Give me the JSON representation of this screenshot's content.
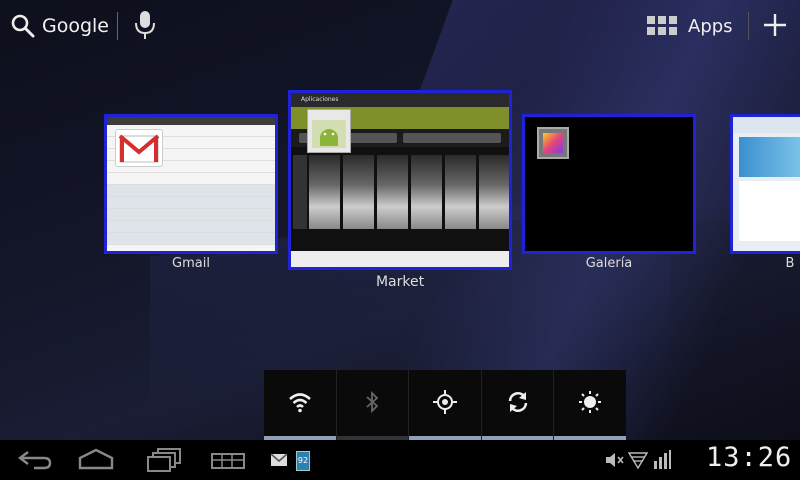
{
  "topbar": {
    "search_label": "Google",
    "apps_label": "Apps"
  },
  "recents": [
    {
      "label": "Gmail"
    },
    {
      "label": "Market"
    },
    {
      "label": "Galería"
    },
    {
      "label": "B"
    }
  ],
  "thumbs": {
    "market_title": "Aplicaciones"
  },
  "quick_settings": [
    {
      "name": "wifi",
      "on": true
    },
    {
      "name": "bluetooth",
      "on": false
    },
    {
      "name": "gps",
      "on": true
    },
    {
      "name": "sync",
      "on": true
    },
    {
      "name": "brightness",
      "on": true
    }
  ],
  "status": {
    "battery_level": "92",
    "time": "13:26"
  },
  "colors": {
    "thumb_border": "#1f22d6",
    "qs_on": "#8fa0b8",
    "battery": "#2e7fae"
  }
}
